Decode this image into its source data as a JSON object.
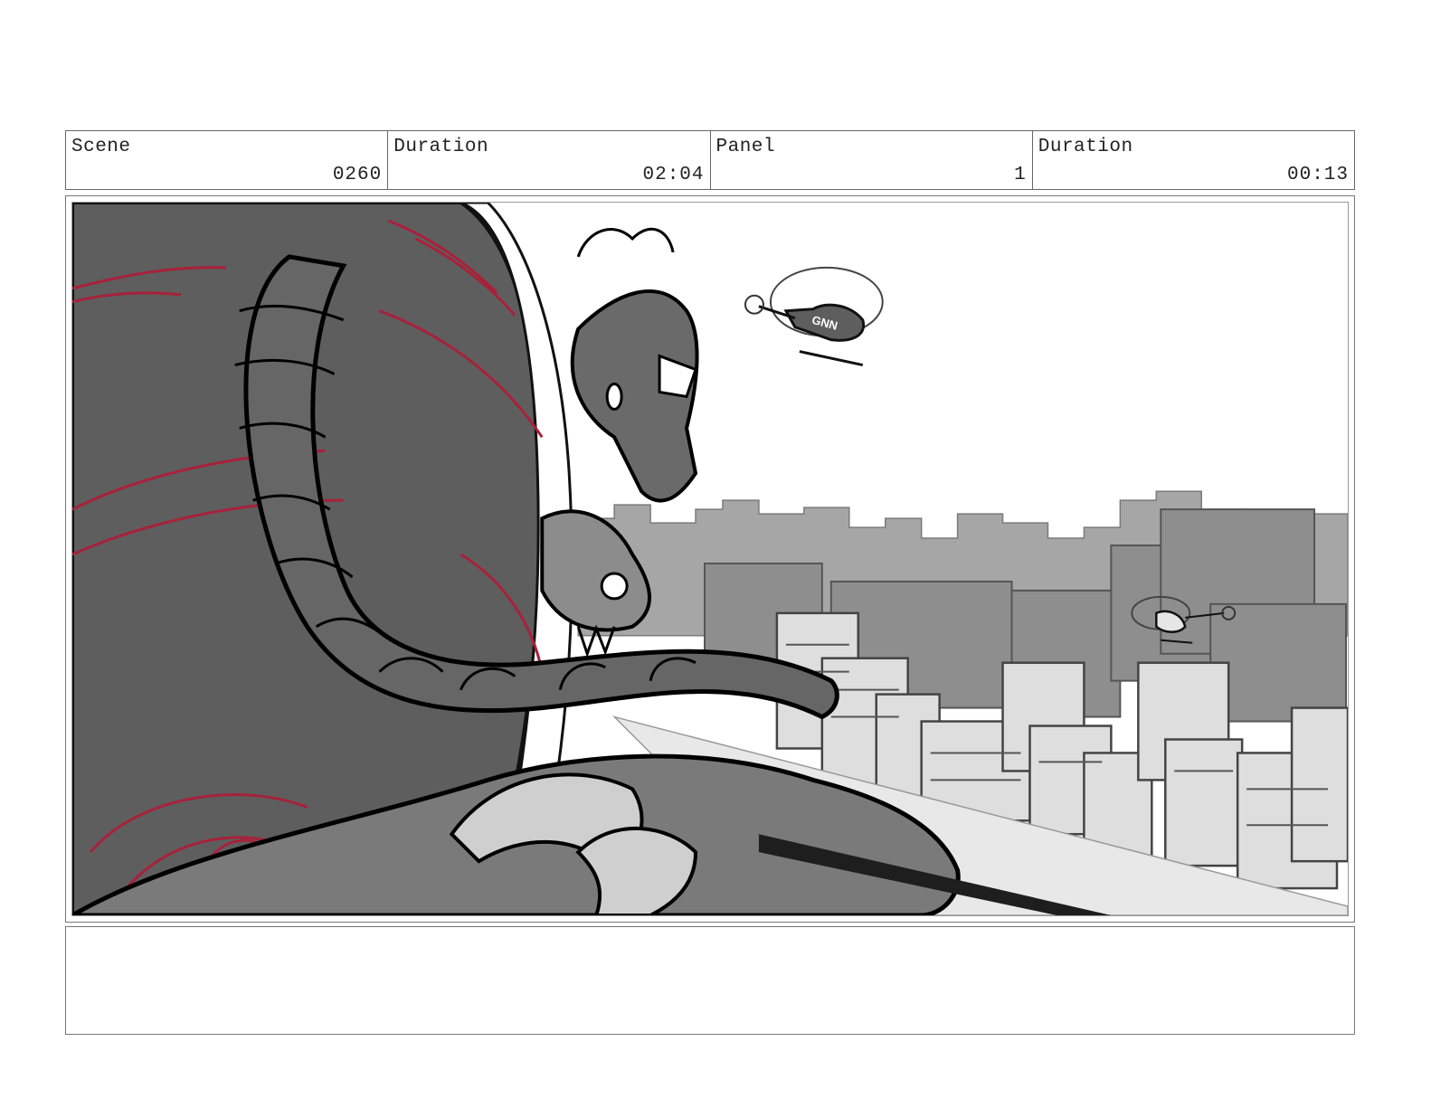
{
  "header": {
    "scene_label": "Scene",
    "scene_value": "0260",
    "scene_duration_label": "Duration",
    "scene_duration_value": "02:04",
    "panel_label": "Panel",
    "panel_value": "1",
    "panel_duration_label": "Duration",
    "panel_duration_value": "00:13"
  },
  "artwork": {
    "helicopter_text": "GNN"
  },
  "notes": {
    "text": ""
  },
  "colors": {
    "sketch_red": "#a8213a",
    "dark_gray": "#5c5c5c",
    "mid_gray": "#8a8a8a",
    "light_gray": "#c8c8c8"
  }
}
